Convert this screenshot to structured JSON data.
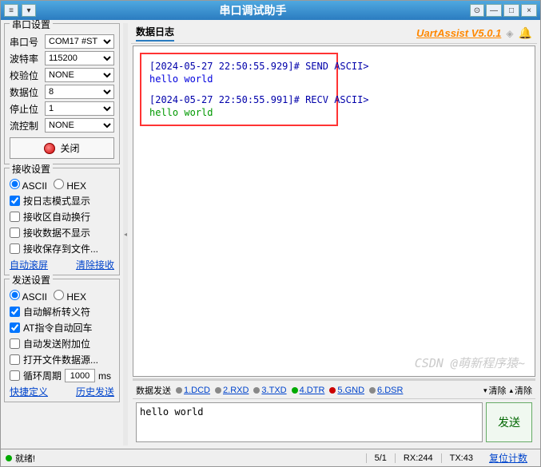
{
  "title": "串口调试助手",
  "brand": "UartAssist V5.0.1",
  "watermark": "CSDN @萌新程序猿~",
  "sidebar": {
    "port": {
      "title": "串口设置",
      "fields": {
        "port_label": "串口号",
        "port_val": "COM17 #ST",
        "baud_label": "波特率",
        "baud_val": "115200",
        "parity_label": "校验位",
        "parity_val": "NONE",
        "data_label": "数据位",
        "data_val": "8",
        "stop_label": "停止位",
        "stop_val": "1",
        "flow_label": "流控制",
        "flow_val": "NONE"
      },
      "close_btn": "关闭"
    },
    "recv": {
      "title": "接收设置",
      "ascii": "ASCII",
      "hex": "HEX",
      "cb1": "按日志模式显示",
      "cb2": "接收区自动换行",
      "cb3": "接收数据不显示",
      "cb4": "接收保存到文件...",
      "link1": "自动滚屏",
      "link2": "清除接收"
    },
    "send": {
      "title": "发送设置",
      "ascii": "ASCII",
      "hex": "HEX",
      "cb1": "自动解析转义符",
      "cb2": "AT指令自动回车",
      "cb3": "自动发送附加位",
      "cb4": "打开文件数据源...",
      "loop_label": "循环周期",
      "loop_val": "1000",
      "loop_unit": "ms",
      "link1": "快捷定义",
      "link2": "历史发送"
    }
  },
  "log": {
    "title": "数据日志",
    "lines": {
      "l1_ts": "[2024-05-27 22:50:55.929]# SEND ASCII>",
      "l1_txt": "hello world",
      "l2_ts": "[2024-05-27 22:50:55.991]# RECV ASCII>",
      "l2_txt": "hello world"
    }
  },
  "sendarea": {
    "title": "数据发送",
    "sig1": "1.DCD",
    "sig2": "2.RXD",
    "sig3": "3.TXD",
    "sig4": "4.DTR",
    "sig5": "5.GND",
    "sig6": "6.DSR",
    "clear1": "清除",
    "clear2": "清除",
    "input": "hello world",
    "btn": "发送"
  },
  "status": {
    "ready": "就绪!",
    "s1": "5/1",
    "s2": "RX:244",
    "s3": "TX:43",
    "s4": "复位计数"
  }
}
